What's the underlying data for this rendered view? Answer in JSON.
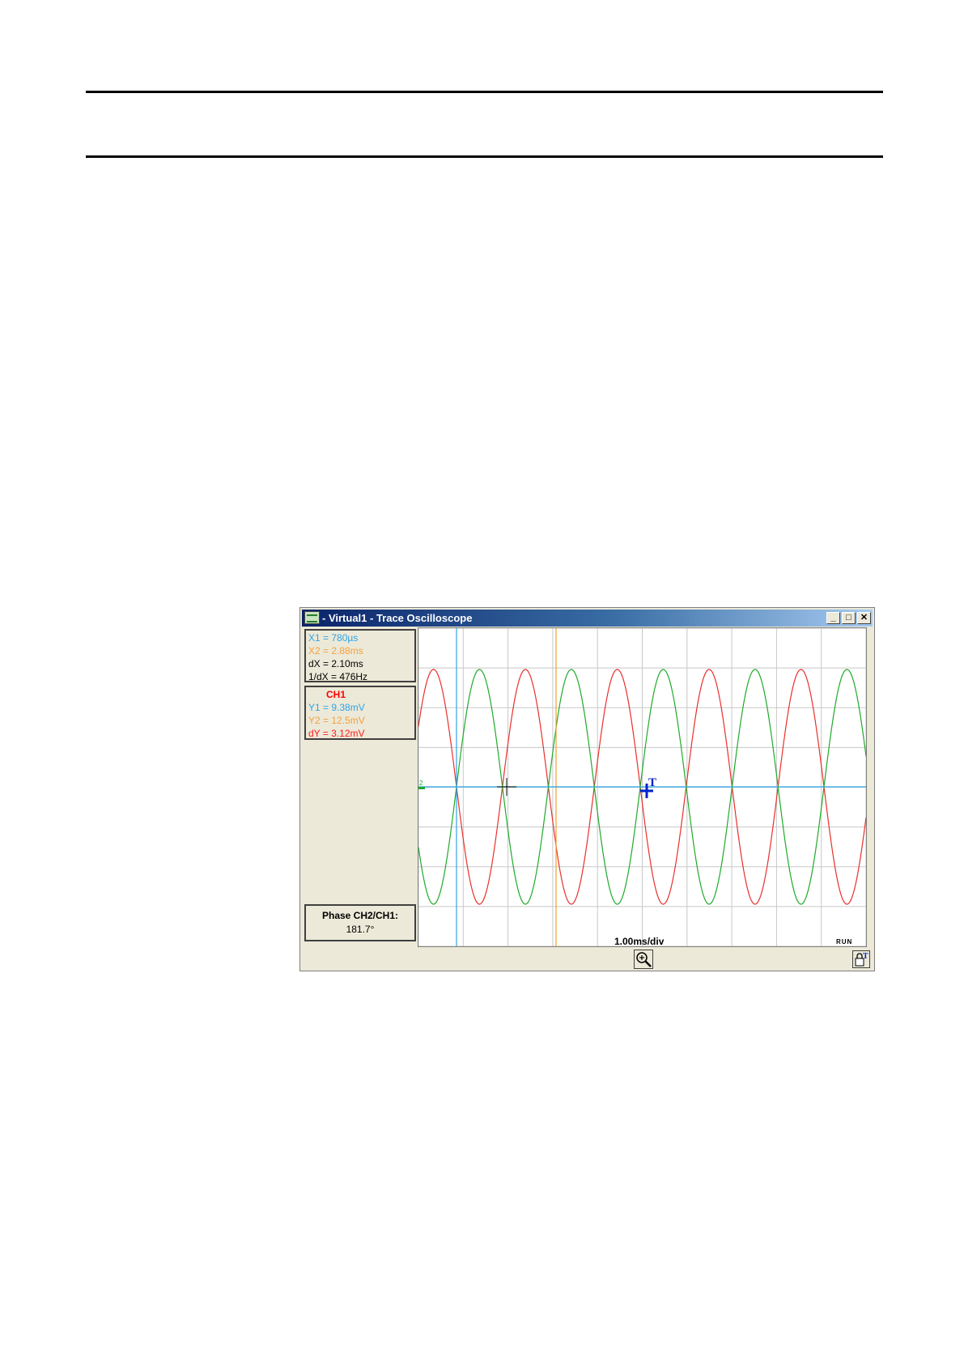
{
  "window": {
    "title": "- Virtual1 - Trace Oscilloscope",
    "controls": {
      "minimize": "_",
      "maximize": "□",
      "close": "✕"
    }
  },
  "cursors": {
    "x1": "X1 = 780µs",
    "x2": "X2 = 2.88ms",
    "dx": "dX = 2.10ms",
    "inv_dx": "1/dX = 476Hz"
  },
  "channel": {
    "name": "CH1",
    "y1": "Y1 = 9.38mV",
    "y2": "Y2 = 12.5mV",
    "dy": "dY = 3.12mV"
  },
  "phase": {
    "label": "Phase CH2/CH1:",
    "value": "181.7°"
  },
  "scope": {
    "timebase": "1.00ms/div",
    "status": "RUN",
    "trigger_marker": "T",
    "ground_marker": "2"
  },
  "colors": {
    "ch1": "#e8302c",
    "ch2": "#1faa2a",
    "cursor_x1": "#2fa4e7",
    "cursor_x2": "#f0a030",
    "trigger": "#0022cc"
  },
  "icons": {
    "zoom": "magnifier-plus-icon",
    "lock": "lock-trigger-icon"
  }
}
